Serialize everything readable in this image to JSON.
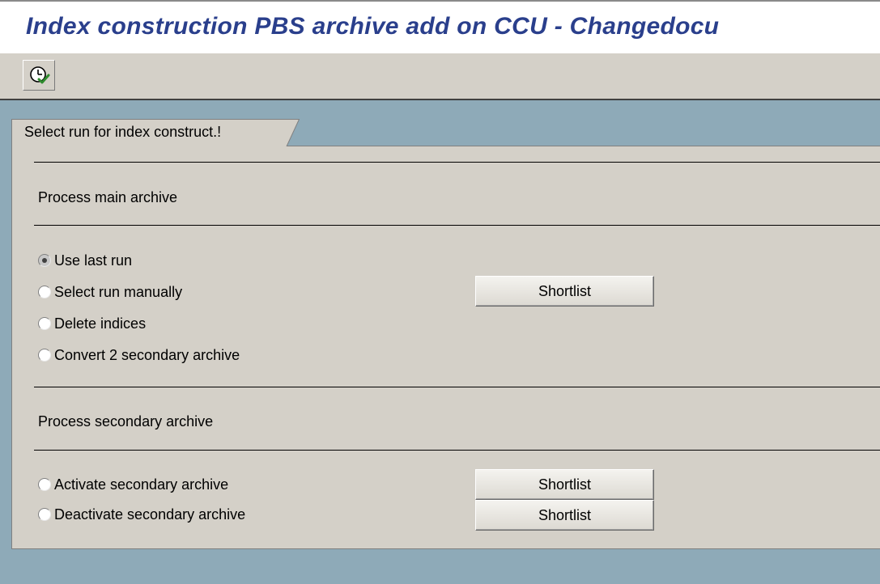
{
  "window": {
    "title": "Index construction PBS archive add on CCU - Changedocu"
  },
  "toolbar": {
    "execute_icon": "execute-clock-icon"
  },
  "tab": {
    "label": "Select run for index construct.!"
  },
  "main_archive": {
    "title": "Process main archive",
    "options": [
      {
        "label": "Use last run",
        "checked": true
      },
      {
        "label": "Select run manually",
        "checked": false
      },
      {
        "label": "Delete indices",
        "checked": false
      },
      {
        "label": "Convert 2 secondary archive",
        "checked": false
      }
    ],
    "shortlist_label": "Shortlist"
  },
  "secondary_archive": {
    "title": "Process secondary archive",
    "options": [
      {
        "label": "Activate secondary archive",
        "checked": false
      },
      {
        "label": "Deactivate secondary archive",
        "checked": false
      }
    ],
    "shortlist_activate_label": "Shortlist",
    "shortlist_deactivate_label": "Shortlist"
  },
  "colors": {
    "title": "#2a3f8c",
    "background": "#d4d0c8",
    "desktop": "#8eaab8"
  }
}
